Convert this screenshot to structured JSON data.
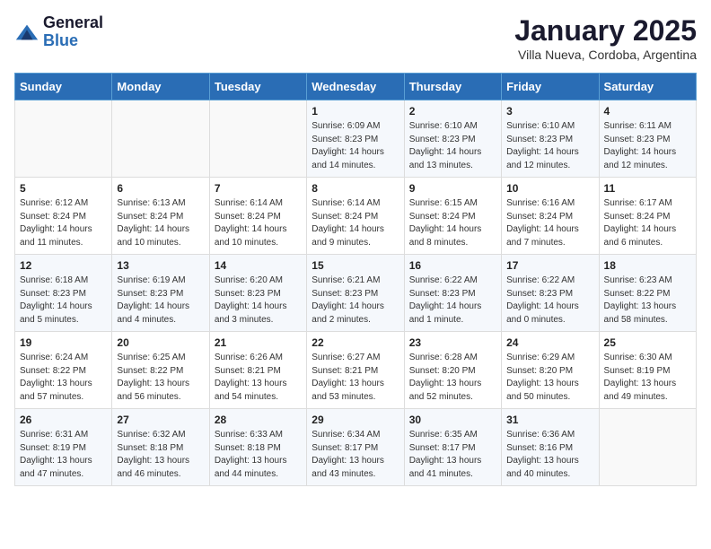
{
  "header": {
    "logo_general": "General",
    "logo_blue": "Blue",
    "month": "January 2025",
    "location": "Villa Nueva, Cordoba, Argentina"
  },
  "weekdays": [
    "Sunday",
    "Monday",
    "Tuesday",
    "Wednesday",
    "Thursday",
    "Friday",
    "Saturday"
  ],
  "weeks": [
    [
      {
        "day": "",
        "info": ""
      },
      {
        "day": "",
        "info": ""
      },
      {
        "day": "",
        "info": ""
      },
      {
        "day": "1",
        "info": "Sunrise: 6:09 AM\nSunset: 8:23 PM\nDaylight: 14 hours\nand 14 minutes."
      },
      {
        "day": "2",
        "info": "Sunrise: 6:10 AM\nSunset: 8:23 PM\nDaylight: 14 hours\nand 13 minutes."
      },
      {
        "day": "3",
        "info": "Sunrise: 6:10 AM\nSunset: 8:23 PM\nDaylight: 14 hours\nand 12 minutes."
      },
      {
        "day": "4",
        "info": "Sunrise: 6:11 AM\nSunset: 8:23 PM\nDaylight: 14 hours\nand 12 minutes."
      }
    ],
    [
      {
        "day": "5",
        "info": "Sunrise: 6:12 AM\nSunset: 8:24 PM\nDaylight: 14 hours\nand 11 minutes."
      },
      {
        "day": "6",
        "info": "Sunrise: 6:13 AM\nSunset: 8:24 PM\nDaylight: 14 hours\nand 10 minutes."
      },
      {
        "day": "7",
        "info": "Sunrise: 6:14 AM\nSunset: 8:24 PM\nDaylight: 14 hours\nand 10 minutes."
      },
      {
        "day": "8",
        "info": "Sunrise: 6:14 AM\nSunset: 8:24 PM\nDaylight: 14 hours\nand 9 minutes."
      },
      {
        "day": "9",
        "info": "Sunrise: 6:15 AM\nSunset: 8:24 PM\nDaylight: 14 hours\nand 8 minutes."
      },
      {
        "day": "10",
        "info": "Sunrise: 6:16 AM\nSunset: 8:24 PM\nDaylight: 14 hours\nand 7 minutes."
      },
      {
        "day": "11",
        "info": "Sunrise: 6:17 AM\nSunset: 8:24 PM\nDaylight: 14 hours\nand 6 minutes."
      }
    ],
    [
      {
        "day": "12",
        "info": "Sunrise: 6:18 AM\nSunset: 8:23 PM\nDaylight: 14 hours\nand 5 minutes."
      },
      {
        "day": "13",
        "info": "Sunrise: 6:19 AM\nSunset: 8:23 PM\nDaylight: 14 hours\nand 4 minutes."
      },
      {
        "day": "14",
        "info": "Sunrise: 6:20 AM\nSunset: 8:23 PM\nDaylight: 14 hours\nand 3 minutes."
      },
      {
        "day": "15",
        "info": "Sunrise: 6:21 AM\nSunset: 8:23 PM\nDaylight: 14 hours\nand 2 minutes."
      },
      {
        "day": "16",
        "info": "Sunrise: 6:22 AM\nSunset: 8:23 PM\nDaylight: 14 hours\nand 1 minute."
      },
      {
        "day": "17",
        "info": "Sunrise: 6:22 AM\nSunset: 8:23 PM\nDaylight: 14 hours\nand 0 minutes."
      },
      {
        "day": "18",
        "info": "Sunrise: 6:23 AM\nSunset: 8:22 PM\nDaylight: 13 hours\nand 58 minutes."
      }
    ],
    [
      {
        "day": "19",
        "info": "Sunrise: 6:24 AM\nSunset: 8:22 PM\nDaylight: 13 hours\nand 57 minutes."
      },
      {
        "day": "20",
        "info": "Sunrise: 6:25 AM\nSunset: 8:22 PM\nDaylight: 13 hours\nand 56 minutes."
      },
      {
        "day": "21",
        "info": "Sunrise: 6:26 AM\nSunset: 8:21 PM\nDaylight: 13 hours\nand 54 minutes."
      },
      {
        "day": "22",
        "info": "Sunrise: 6:27 AM\nSunset: 8:21 PM\nDaylight: 13 hours\nand 53 minutes."
      },
      {
        "day": "23",
        "info": "Sunrise: 6:28 AM\nSunset: 8:20 PM\nDaylight: 13 hours\nand 52 minutes."
      },
      {
        "day": "24",
        "info": "Sunrise: 6:29 AM\nSunset: 8:20 PM\nDaylight: 13 hours\nand 50 minutes."
      },
      {
        "day": "25",
        "info": "Sunrise: 6:30 AM\nSunset: 8:19 PM\nDaylight: 13 hours\nand 49 minutes."
      }
    ],
    [
      {
        "day": "26",
        "info": "Sunrise: 6:31 AM\nSunset: 8:19 PM\nDaylight: 13 hours\nand 47 minutes."
      },
      {
        "day": "27",
        "info": "Sunrise: 6:32 AM\nSunset: 8:18 PM\nDaylight: 13 hours\nand 46 minutes."
      },
      {
        "day": "28",
        "info": "Sunrise: 6:33 AM\nSunset: 8:18 PM\nDaylight: 13 hours\nand 44 minutes."
      },
      {
        "day": "29",
        "info": "Sunrise: 6:34 AM\nSunset: 8:17 PM\nDaylight: 13 hours\nand 43 minutes."
      },
      {
        "day": "30",
        "info": "Sunrise: 6:35 AM\nSunset: 8:17 PM\nDaylight: 13 hours\nand 41 minutes."
      },
      {
        "day": "31",
        "info": "Sunrise: 6:36 AM\nSunset: 8:16 PM\nDaylight: 13 hours\nand 40 minutes."
      },
      {
        "day": "",
        "info": ""
      }
    ]
  ]
}
